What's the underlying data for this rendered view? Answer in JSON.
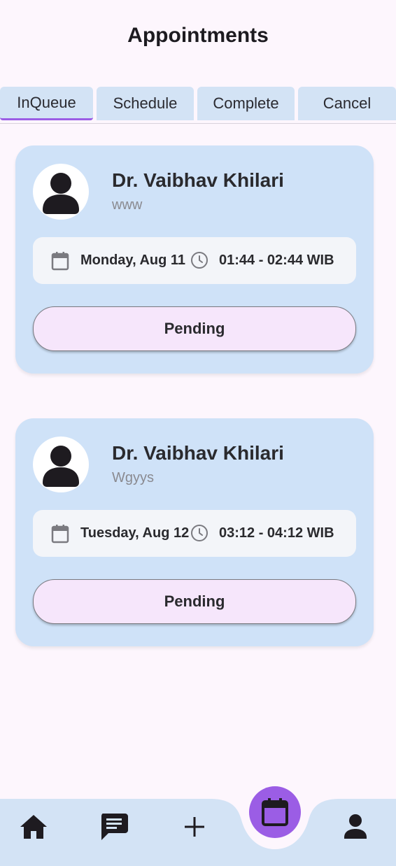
{
  "page": {
    "title": "Appointments"
  },
  "tabs": [
    {
      "label": "InQueue",
      "active": true
    },
    {
      "label": "Schedule",
      "active": false
    },
    {
      "label": "Complete",
      "active": false
    },
    {
      "label": "Cancel",
      "active": false
    }
  ],
  "appointments": [
    {
      "doctor": "Dr. Vaibhav Khilari",
      "note": "www",
      "date": "Monday, Aug 11",
      "time": "01:44 - 02:44 WIB",
      "status": "Pending"
    },
    {
      "doctor": "Dr. Vaibhav Khilari",
      "note": "Wgyys",
      "date": "Tuesday, Aug 12",
      "time": "03:12 - 04:12 WIB",
      "status": "Pending"
    }
  ],
  "nav": {
    "items": [
      "home-icon",
      "chat-icon",
      "add-icon",
      "calendar-icon",
      "person-icon"
    ],
    "active": "calendar-icon"
  },
  "colors": {
    "background": "#fdf6fd",
    "card": "#cfe2f8",
    "tab": "#d3e3f5",
    "accent": "#9b5de5",
    "status_button": "#f6e6fb"
  }
}
